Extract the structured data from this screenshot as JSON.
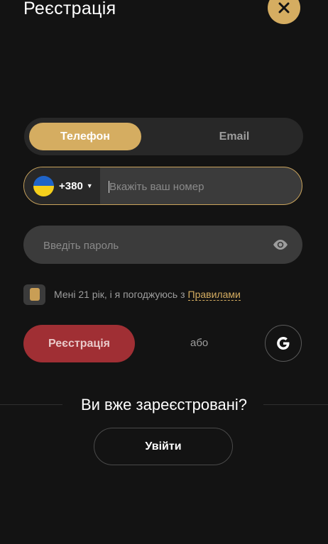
{
  "header": {
    "title": "Реєстрація",
    "close_icon": "close-icon"
  },
  "tabs": {
    "phone_label": "Телефон",
    "email_label": "Email",
    "active": "phone"
  },
  "phone": {
    "country_flag": "ukraine-flag-icon",
    "country_code": "+380",
    "placeholder": "Вкажіть ваш номер",
    "value": ""
  },
  "password": {
    "placeholder": "Введіть пароль",
    "value": "",
    "toggle_icon": "eye-icon"
  },
  "agreement": {
    "text": "Мені 21 рік, і я погоджуюсь з",
    "link_text": "Правилами"
  },
  "actions": {
    "register_label": "Реєстрація",
    "or_label": "або",
    "google_icon": "google-icon"
  },
  "footer": {
    "already_registered": "Ви вже зареєстровані?",
    "login_label": "Увійти"
  },
  "colors": {
    "background": "#131313",
    "accent_gold": "#d5ad61",
    "register_red": "#a02f34",
    "field_bg": "#3b3b3b"
  }
}
